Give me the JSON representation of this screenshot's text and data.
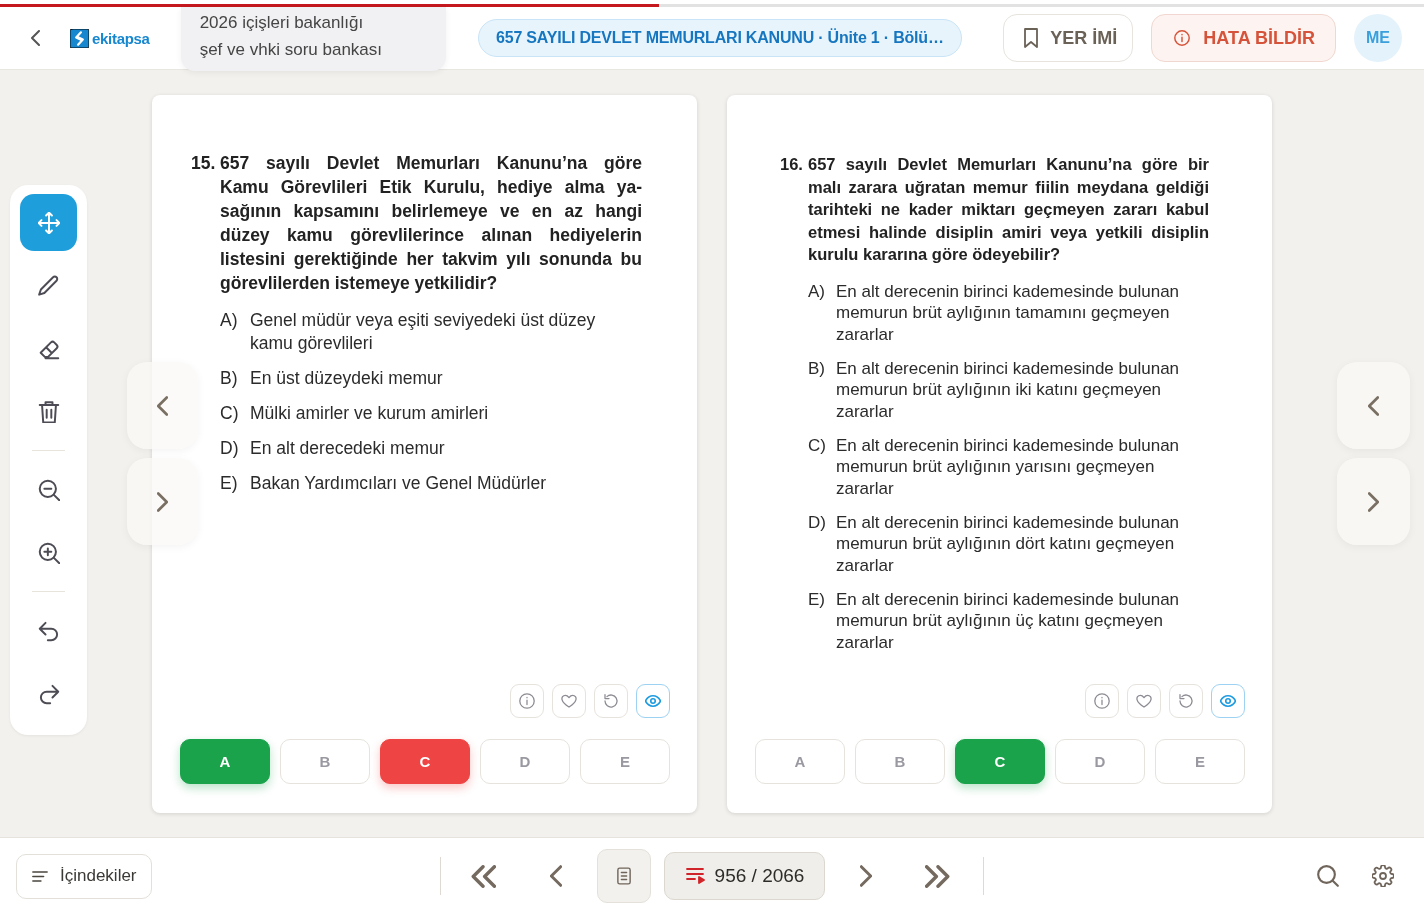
{
  "reading_progress": {
    "level": 0.463
  },
  "header": {
    "logo_text": "ekitapsa",
    "book_title_lines": [
      "2026 içişleri bakanlığı",
      "şef ve vhki soru bankası"
    ],
    "chapter": "657 SAYILI DEVLET MEMURLARI KANUNU · Ünite 1 · Bölü…",
    "bookmark_button": "YER İMİ",
    "report_button": "HATA BİLDİR",
    "avatar_initials": "ME"
  },
  "tool_groups": [
    [
      {
        "kind": "move",
        "selected": true
      },
      {
        "kind": "pencil",
        "selected": false
      },
      {
        "kind": "eraser",
        "selected": false
      },
      {
        "kind": "trash",
        "selected": false
      }
    ],
    [
      {
        "kind": "zoom_out",
        "selected": false
      },
      {
        "kind": "zoom_in",
        "selected": false
      }
    ],
    [
      {
        "kind": "undo",
        "selected": false
      },
      {
        "kind": "redo",
        "selected": false
      }
    ]
  ],
  "pages": [
    {
      "number": "15.",
      "stem_lines": [
        "657 sayılı Devlet Memurları Kanunu’na göre",
        "Kamu Görevlileri Etik Kurulu, hediye alma ya-",
        "sağının kapsamını belirlemeye ve en az hangi",
        "düzey kamu görevlilerince alınan hediyelerin",
        "listesini gerektiğinde her takvim yılı sonunda bu",
        "görevlilerden istemeye yetkilidir?"
      ],
      "options": [
        {
          "label": "A)",
          "text": "Genel müdür veya eşiti seviyedeki üst düzey kamu görevlileri"
        },
        {
          "label": "B)",
          "text": "En üst düzeydeki memur"
        },
        {
          "label": "C)",
          "text": "Mülki amirler ve kurum amirleri"
        },
        {
          "label": "D)",
          "text": "En alt derecedeki memur"
        },
        {
          "label": "E)",
          "text": "Bakan Yardımcıları ve Genel Müdürler"
        }
      ],
      "actions": [
        {
          "kind": "info",
          "selected": false
        },
        {
          "kind": "heart",
          "selected": false
        },
        {
          "kind": "reset",
          "selected": false
        },
        {
          "kind": "eye",
          "selected": true
        }
      ],
      "answers": [
        {
          "letter": "A",
          "kind": "correct"
        },
        {
          "letter": "B",
          "kind": "plain"
        },
        {
          "letter": "C",
          "kind": "wrong"
        },
        {
          "letter": "D",
          "kind": "plain"
        },
        {
          "letter": "E",
          "kind": "plain"
        }
      ]
    },
    {
      "number": "16.",
      "stem_lines": [
        "657 sayılı Devlet Memurları Kanunu’na göre bir",
        "malı zarara uğratan memur fiilin meydana geldiği",
        "tarihteki ne kader miktarı geçmeyen zararı kabul",
        "etmesi halinde disiplin amiri veya yetkili disiplin",
        "kurulu kararına göre ödeyebilir?"
      ],
      "options": [
        {
          "label": "A)",
          "text": "En alt derecenin birinci kademesinde bulunan memurun brüt aylığının tamamını geçmeyen zararlar"
        },
        {
          "label": "B)",
          "text": "En alt derecenin birinci kademesinde bulunan memurun brüt aylığının iki katını geçmeyen zararlar"
        },
        {
          "label": "C)",
          "text": "En alt derecenin birinci kademesinde bulunan memurun brüt aylığının yarısını geçmeyen zararlar"
        },
        {
          "label": "D)",
          "text": "En alt derecenin birinci kademesinde bulunan memurun brüt aylığının dört katını geçmeyen zararlar"
        },
        {
          "label": "E)",
          "text": "En alt derecenin birinci kademesinde bulunan memurun brüt aylığının üç katını geçmeyen zararlar"
        }
      ],
      "actions": [
        {
          "kind": "info",
          "selected": false
        },
        {
          "kind": "heart",
          "selected": false
        },
        {
          "kind": "reset",
          "selected": false
        },
        {
          "kind": "eye",
          "selected": true
        }
      ],
      "answers": [
        {
          "letter": "A",
          "kind": "plain"
        },
        {
          "letter": "B",
          "kind": "plain"
        },
        {
          "letter": "C",
          "kind": "correct"
        },
        {
          "letter": "D",
          "kind": "plain"
        },
        {
          "letter": "E",
          "kind": "plain"
        }
      ]
    }
  ],
  "footer": {
    "toc_button": "İçindekiler",
    "page_counter": "956 / 2066"
  }
}
